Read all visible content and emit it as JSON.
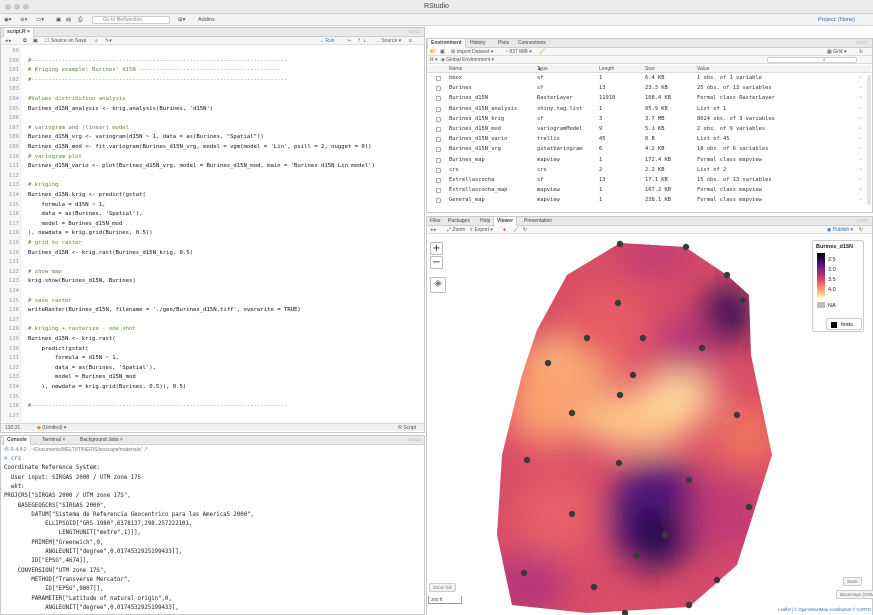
{
  "window": {
    "title": "RStudio"
  },
  "toolbar": {
    "goto_placeholder": "Go to file/function",
    "addins": "Addins",
    "project": "Project: (None)"
  },
  "editor": {
    "file_tab": "script.R",
    "source_on_save": "Source on Save",
    "run": "Run",
    "source": "Source",
    "lines": [
      {
        "n": "99",
        "t": "",
        "c": "plain"
      },
      {
        "n": "100",
        "t": "#----------------------------------------------------------------------------",
        "c": "cm"
      },
      {
        "n": "101",
        "t": "# Kriging example: Burines' d15N ------------------------------------------",
        "c": "cm"
      },
      {
        "n": "102",
        "t": "#----------------------------------------------------------------------------",
        "c": "cm"
      },
      {
        "n": "103",
        "t": "",
        "c": "plain"
      },
      {
        "n": "104",
        "t": "#Values distribution analysis",
        "c": "cm"
      },
      {
        "n": "105",
        "t": "Burines_d15N_analysis <- krig.analysis(Burines, 'd15N')",
        "c": "plain"
      },
      {
        "n": "106",
        "t": "",
        "c": "plain"
      },
      {
        "n": "107",
        "t": "# variogram and (linear) model",
        "c": "cm"
      },
      {
        "n": "108",
        "t": "Burines_d15N_vrg <- variogram(d15N ~ 1, data = as(Burines, \"Spatial\"))",
        "c": "plain"
      },
      {
        "n": "109",
        "t": "Burines_d15N_mod <- fit.variogram(Burines_d15N_vrg, model = vgm(model = 'Lin', psill = 2, nugget = 0))",
        "c": "plain"
      },
      {
        "n": "110",
        "t": "# variogram plot",
        "c": "cm"
      },
      {
        "n": "111",
        "t": "Burines_d15N_vario <- plot(Burines_d15N_vrg, model = Burines_d15N_mod, main = 'Burines d15N Lin model')",
        "c": "plain"
      },
      {
        "n": "112",
        "t": "",
        "c": "plain"
      },
      {
        "n": "113",
        "t": "# kriging",
        "c": "cm"
      },
      {
        "n": "114",
        "t": "Burines_d15N.krig <- predict(gstat(",
        "c": "plain"
      },
      {
        "n": "115",
        "t": "    formula = d15N ~ 1,",
        "c": "plain"
      },
      {
        "n": "116",
        "t": "    data = as(Burines, 'Spatial'),",
        "c": "plain"
      },
      {
        "n": "117",
        "t": "    model = Burines_d15N_mod",
        "c": "plain"
      },
      {
        "n": "118",
        "t": "), newdata = krig.grid(Burines, 0.5))",
        "c": "plain"
      },
      {
        "n": "119",
        "t": "# grid to raster",
        "c": "cm"
      },
      {
        "n": "120",
        "t": "Burines_d15N <- krig.rast(Burines_d15N_krig, 0.5)",
        "c": "plain"
      },
      {
        "n": "121",
        "t": "",
        "c": "plain"
      },
      {
        "n": "122",
        "t": "# show map",
        "c": "cm"
      },
      {
        "n": "123",
        "t": "krig.show(Burines_d15N, Burines)",
        "c": "plain"
      },
      {
        "n": "124",
        "t": "",
        "c": "plain"
      },
      {
        "n": "125",
        "t": "# save raster",
        "c": "cm"
      },
      {
        "n": "126",
        "t": "writeRaster(Burines_d15N, filename = './geo/Burines_d15N.tiff', overwrite = TRUE)",
        "c": "plain"
      },
      {
        "n": "127",
        "t": "",
        "c": "plain"
      },
      {
        "n": "128",
        "t": "# kriging + rasterize - one shot",
        "c": "cm"
      },
      {
        "n": "129",
        "t": "Burines_d15N <- krig.rast(",
        "c": "plain"
      },
      {
        "n": "130",
        "t": "    predict(gstat(",
        "c": "plain"
      },
      {
        "n": "131",
        "t": "        formula = d15N ~ 1,",
        "c": "plain"
      },
      {
        "n": "132",
        "t": "        data = as(Burines, 'Spatial'),",
        "c": "plain"
      },
      {
        "n": "133",
        "t": "        model = Burines_d15N_mod",
        "c": "plain"
      },
      {
        "n": "134",
        "t": "    ), newdata = krig.grid(Burines, 0.5)), 0.5)",
        "c": "plain"
      },
      {
        "n": "135",
        "t": "",
        "c": "plain"
      },
      {
        "n": "136",
        "t": "#----------------------------------------------------------------------------",
        "c": "cm"
      },
      {
        "n": "137",
        "t": "",
        "c": "plain"
      }
    ],
    "status_pos": "132:31",
    "status_scope": "(Untitled)",
    "status_type": "R Script"
  },
  "console": {
    "tabs": [
      "Console",
      "Terminal",
      "Background Jobs"
    ],
    "path": "R 4.4.2 · ~/Documents/MELT/ITINERIS/isoscape/materials/",
    "lines": [
      "> crs",
      "Coordinate Reference System:",
      "  User input: SIRGAS 2000 / UTM zone 17S",
      "  wkt:",
      "PROJCRS[\"SIRGAS 2000 / UTM zone 17S\",",
      "    BASEGEOGCRS[\"SIRGAS 2000\",",
      "        DATUM[\"Sistema de Referencia Geocentrico para las AmericaS 2000\",",
      "            ELLIPSOID[\"GRS 1980\",6378137,298.257222101,",
      "                LENGTHUNIT[\"metre\",1]]],",
      "        PRIMEM[\"Greenwich\",0,",
      "            ANGLEUNIT[\"degree\",0.0174532925199433]],",
      "        ID[\"EPSG\",4674]],",
      "    CONVERSION[\"UTM zone 17S\",",
      "        METHOD[\"Transverse Mercator\",",
      "            ID[\"EPSG\",9807]],",
      "        PARAMETER[\"Latitude of natural origin\",0,",
      "            ANGLEUNIT[\"degree\",0.0174532925199433],"
    ]
  },
  "environment": {
    "tabs": [
      "Environment",
      "History",
      "Plots",
      "Connections"
    ],
    "import": "Import Dataset",
    "memory": "837 MiB",
    "list_view": "Grid",
    "scope": "Global Environment",
    "headers": [
      "Name",
      "Type",
      "Length",
      "Size",
      "Value"
    ],
    "rows": [
      {
        "name": "bbox",
        "type": "sf",
        "length": "1",
        "size": "6.4 KB",
        "value": "1 obs. of 1 variable"
      },
      {
        "name": "Burines",
        "type": "sf",
        "length": "13",
        "size": "23.3 KB",
        "value": "25 obs. of 13 variables"
      },
      {
        "name": "Burines_d15N",
        "type": "RasterLayer",
        "length": "11918",
        "size": "108.4 KB",
        "value": "Formal class RasterLayer"
      },
      {
        "name": "Burines_d15N_analysis",
        "type": "shiny.tag.list",
        "length": "1",
        "size": "95.9 KB",
        "value": "List of 1"
      },
      {
        "name": "Burines_d15N_krig",
        "type": "sf",
        "length": "3",
        "size": "3.7 MB",
        "value": "8624 obs. of 3 variables"
      },
      {
        "name": "Burines_d15N_mod",
        "type": "variogramModel",
        "length": "9",
        "size": "5.1 KB",
        "value": "2 obs. of 9 variables"
      },
      {
        "name": "Burines_d15N_vario",
        "type": "trellis",
        "length": "45",
        "size": "0 B",
        "value": "List of 45"
      },
      {
        "name": "Burines_d15N_vrg",
        "type": "gstatVariogram",
        "length": "6",
        "size": "4.2 KB",
        "value": "18 obs. of 6 variables"
      },
      {
        "name": "Burines_map",
        "type": "mapview",
        "length": "1",
        "size": "172.4 KB",
        "value": "Formal class mapview"
      },
      {
        "name": "crs",
        "type": "crs",
        "length": "2",
        "size": "2.2 KB",
        "value": "List of 2"
      },
      {
        "name": "Estrellascocha",
        "type": "sf",
        "length": "13",
        "size": "17.1 KB",
        "value": "15 obs. of 13 variables"
      },
      {
        "name": "Estrellascocha_map",
        "type": "mapview",
        "length": "1",
        "size": "167.2 KB",
        "value": "Formal class mapview"
      },
      {
        "name": "General_map",
        "type": "mapview",
        "length": "1",
        "size": "238.1 KB",
        "value": "Formal class mapview"
      }
    ]
  },
  "viewer": {
    "tabs": [
      "Files",
      "Packages",
      "Help",
      "Viewer",
      "Presentation"
    ],
    "zoom": "Zoom",
    "export": "Export",
    "publish": "Publish",
    "legend_title": "Burines_d15N",
    "legend_ticks": [
      "2.5",
      "3.0",
      "3.5",
      "4.0"
    ],
    "legend_na": "NA",
    "features_label": "feats",
    "zoom_full": "Zoom full",
    "scale": "200 ft",
    "attribution": "Leaflet | © OpenStreetMap contributors © CARTO",
    "btn_right1": "Static",
    "btn_right2": "Basemaps (OSM)"
  }
}
